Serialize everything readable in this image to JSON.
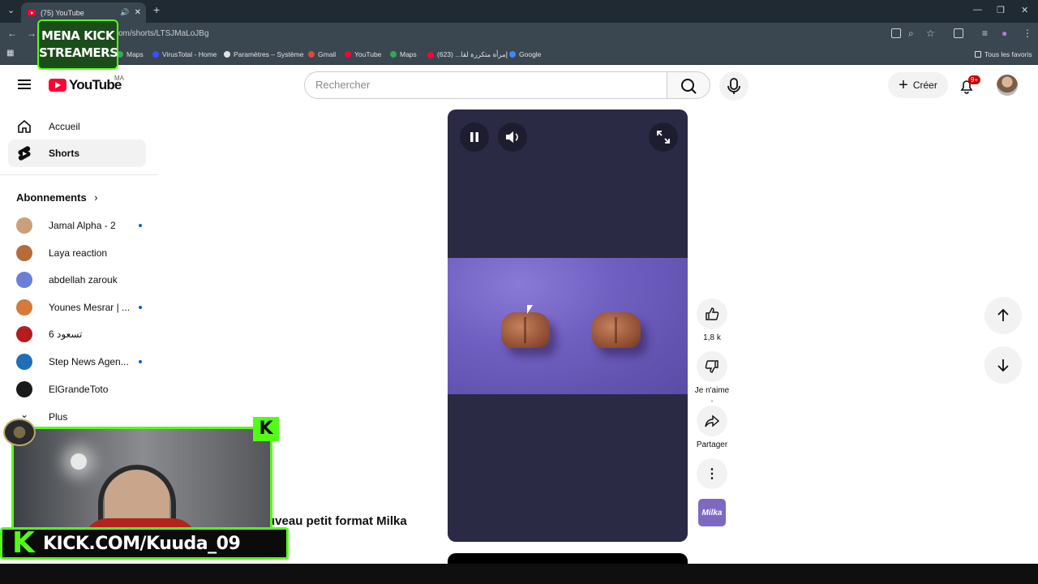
{
  "browser": {
    "tab_title": "(75) YouTube",
    "url": "om/shorts/LTSJMaLoJBg",
    "bookmarks": [
      "Maps",
      "VirusTotal - Home",
      "Paramètres – Système",
      "Gmail",
      "YouTube",
      "Maps",
      "إمرأة متكررة لقا... (623)",
      "Google"
    ],
    "all_bookmarks": "Tous les favoris"
  },
  "header": {
    "logo": "YouTube",
    "country": "MA",
    "search_placeholder": "Rechercher",
    "create_label": "Créer",
    "notif_count": "9+"
  },
  "sidebar": {
    "nav": [
      {
        "label": "Accueil",
        "icon": "home-icon"
      },
      {
        "label": "Shorts",
        "icon": "shorts-icon"
      }
    ],
    "subs_heading": "Abonnements",
    "subscriptions": [
      {
        "name": "Jamal Alpha - 2",
        "color": "#c9a078",
        "live": true
      },
      {
        "name": "Laya reaction",
        "color": "#b56b3a",
        "live": false
      },
      {
        "name": "abdellah zarouk",
        "color": "#6b7fd9",
        "live": false
      },
      {
        "name": "Younes Mesrar | ...",
        "color": "#d47a3a",
        "live": true
      },
      {
        "name": "تسعود 6",
        "color": "#b31d1d",
        "live": false
      },
      {
        "name": "Step News Agen...",
        "color": "#1e6fb5",
        "live": true
      },
      {
        "name": "ElGrandeToto",
        "color": "#1a1a1a",
        "live": false
      }
    ],
    "more_label": "Plus"
  },
  "short": {
    "title": "uveau petit format Milka",
    "likes": "1,8 k",
    "dislike_label": "Je n'aime .",
    "share_label": "Partager",
    "channel_badge": "Milka"
  },
  "overlay": {
    "kick_url": "KICK.COM/Kuuda_09",
    "kick_letter": "K",
    "mena_line1": "MENA KICK",
    "mena_line2": "STREAMERS"
  }
}
